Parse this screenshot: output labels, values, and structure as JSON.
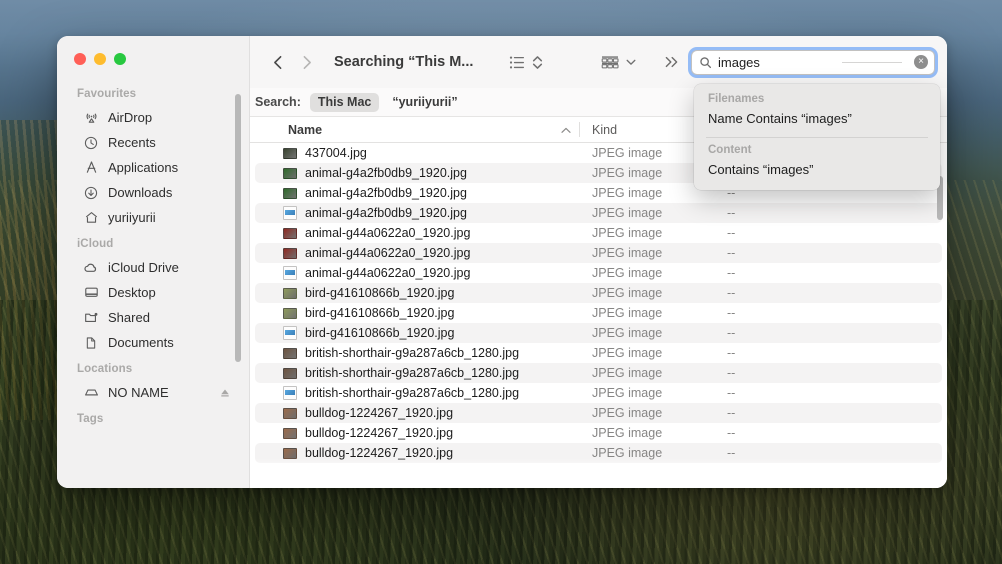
{
  "window": {
    "title": "Searching “This M...",
    "traffic_lights": [
      "close",
      "minimize",
      "zoom"
    ]
  },
  "sidebar": {
    "sections": [
      {
        "title": "Favourites",
        "items": [
          {
            "label": "AirDrop",
            "icon": "airdrop-icon"
          },
          {
            "label": "Recents",
            "icon": "clock-icon"
          },
          {
            "label": "Applications",
            "icon": "applications-icon"
          },
          {
            "label": "Downloads",
            "icon": "download-icon"
          },
          {
            "label": "yuriiyurii",
            "icon": "home-icon"
          }
        ]
      },
      {
        "title": "iCloud",
        "items": [
          {
            "label": "iCloud Drive",
            "icon": "cloud-icon"
          },
          {
            "label": "Desktop",
            "icon": "desktop-icon"
          },
          {
            "label": "Shared",
            "icon": "shared-folder-icon"
          },
          {
            "label": "Documents",
            "icon": "document-icon"
          }
        ]
      },
      {
        "title": "Locations",
        "items": [
          {
            "label": "NO NAME",
            "icon": "external-drive-icon",
            "eject": true
          }
        ]
      },
      {
        "title": "Tags",
        "items": []
      }
    ]
  },
  "toolbar": {
    "back_label": "Back",
    "forward_label": "Forward",
    "view_list_label": "List view",
    "arrange_label": "Group items",
    "more_label": "More toolbar items"
  },
  "search": {
    "value": "images",
    "placeholder": "Search",
    "clear_label": "×"
  },
  "suggestions": {
    "groups": [
      {
        "heading": "Filenames",
        "items": [
          "Name Contains “images”"
        ]
      },
      {
        "heading": "Content",
        "items": [
          "Contains “images”"
        ]
      }
    ]
  },
  "scope_bar": {
    "label": "Search:",
    "options": [
      "This Mac",
      "“yuriiyurii”"
    ],
    "selected": "This Mac"
  },
  "file_list": {
    "columns": [
      "Name",
      "Kind",
      ""
    ],
    "sort_column": "Name",
    "sort_direction": "ascending",
    "rows": [
      {
        "name": "437004.jpg",
        "kind": "JPEG image",
        "extra": "",
        "icon": "jpeg-thumb",
        "color": "#3a4430"
      },
      {
        "name": "animal-g4a2fb0db9_1920.jpg",
        "kind": "JPEG image",
        "extra": "",
        "icon": "jpeg-thumb",
        "color": "#2f6a2a"
      },
      {
        "name": "animal-g4a2fb0db9_1920.jpg",
        "kind": "JPEG image",
        "extra": "--",
        "icon": "jpeg-thumb",
        "color": "#2f6a2a"
      },
      {
        "name": "animal-g4a2fb0db9_1920.jpg",
        "kind": "JPEG image",
        "extra": "--",
        "icon": "doc-thumb",
        "color": "#ffffff"
      },
      {
        "name": "animal-g44a0622a0_1920.jpg",
        "kind": "JPEG image",
        "extra": "--",
        "icon": "jpeg-thumb",
        "color": "#8e2a22"
      },
      {
        "name": "animal-g44a0622a0_1920.jpg",
        "kind": "JPEG image",
        "extra": "--",
        "icon": "jpeg-thumb",
        "color": "#8e2a22"
      },
      {
        "name": "animal-g44a0622a0_1920.jpg",
        "kind": "JPEG image",
        "extra": "--",
        "icon": "doc-thumb",
        "color": "#ffffff"
      },
      {
        "name": "bird-g41610866b_1920.jpg",
        "kind": "JPEG image",
        "extra": "--",
        "icon": "jpeg-thumb",
        "color": "#8d9a5a"
      },
      {
        "name": "bird-g41610866b_1920.jpg",
        "kind": "JPEG image",
        "extra": "--",
        "icon": "jpeg-thumb",
        "color": "#8d9a5a"
      },
      {
        "name": "bird-g41610866b_1920.jpg",
        "kind": "JPEG image",
        "extra": "--",
        "icon": "doc-thumb",
        "color": "#ffffff"
      },
      {
        "name": "british-shorthair-g9a287a6cb_1280.jpg",
        "kind": "JPEG image",
        "extra": "--",
        "icon": "jpeg-thumb",
        "color": "#6d5440"
      },
      {
        "name": "british-shorthair-g9a287a6cb_1280.jpg",
        "kind": "JPEG image",
        "extra": "--",
        "icon": "jpeg-thumb",
        "color": "#6d5440"
      },
      {
        "name": "british-shorthair-g9a287a6cb_1280.jpg",
        "kind": "JPEG image",
        "extra": "--",
        "icon": "doc-thumb",
        "color": "#ffffff"
      },
      {
        "name": "bulldog-1224267_1920.jpg",
        "kind": "JPEG image",
        "extra": "--",
        "icon": "jpeg-thumb",
        "color": "#9a6a4a"
      },
      {
        "name": "bulldog-1224267_1920.jpg",
        "kind": "JPEG image",
        "extra": "--",
        "icon": "jpeg-thumb",
        "color": "#9a6a4a"
      },
      {
        "name": "bulldog-1224267_1920.jpg",
        "kind": "JPEG image",
        "extra": "--",
        "icon": "jpeg-thumb",
        "color": "#9a6a4a"
      }
    ]
  },
  "colors": {
    "accent": "#468cf5",
    "sidebar_bg": "#f2f1f1",
    "window_bg": "#ffffff",
    "traffic_red": "#ff5f57",
    "traffic_yellow": "#febc2e",
    "traffic_green": "#28c840"
  }
}
